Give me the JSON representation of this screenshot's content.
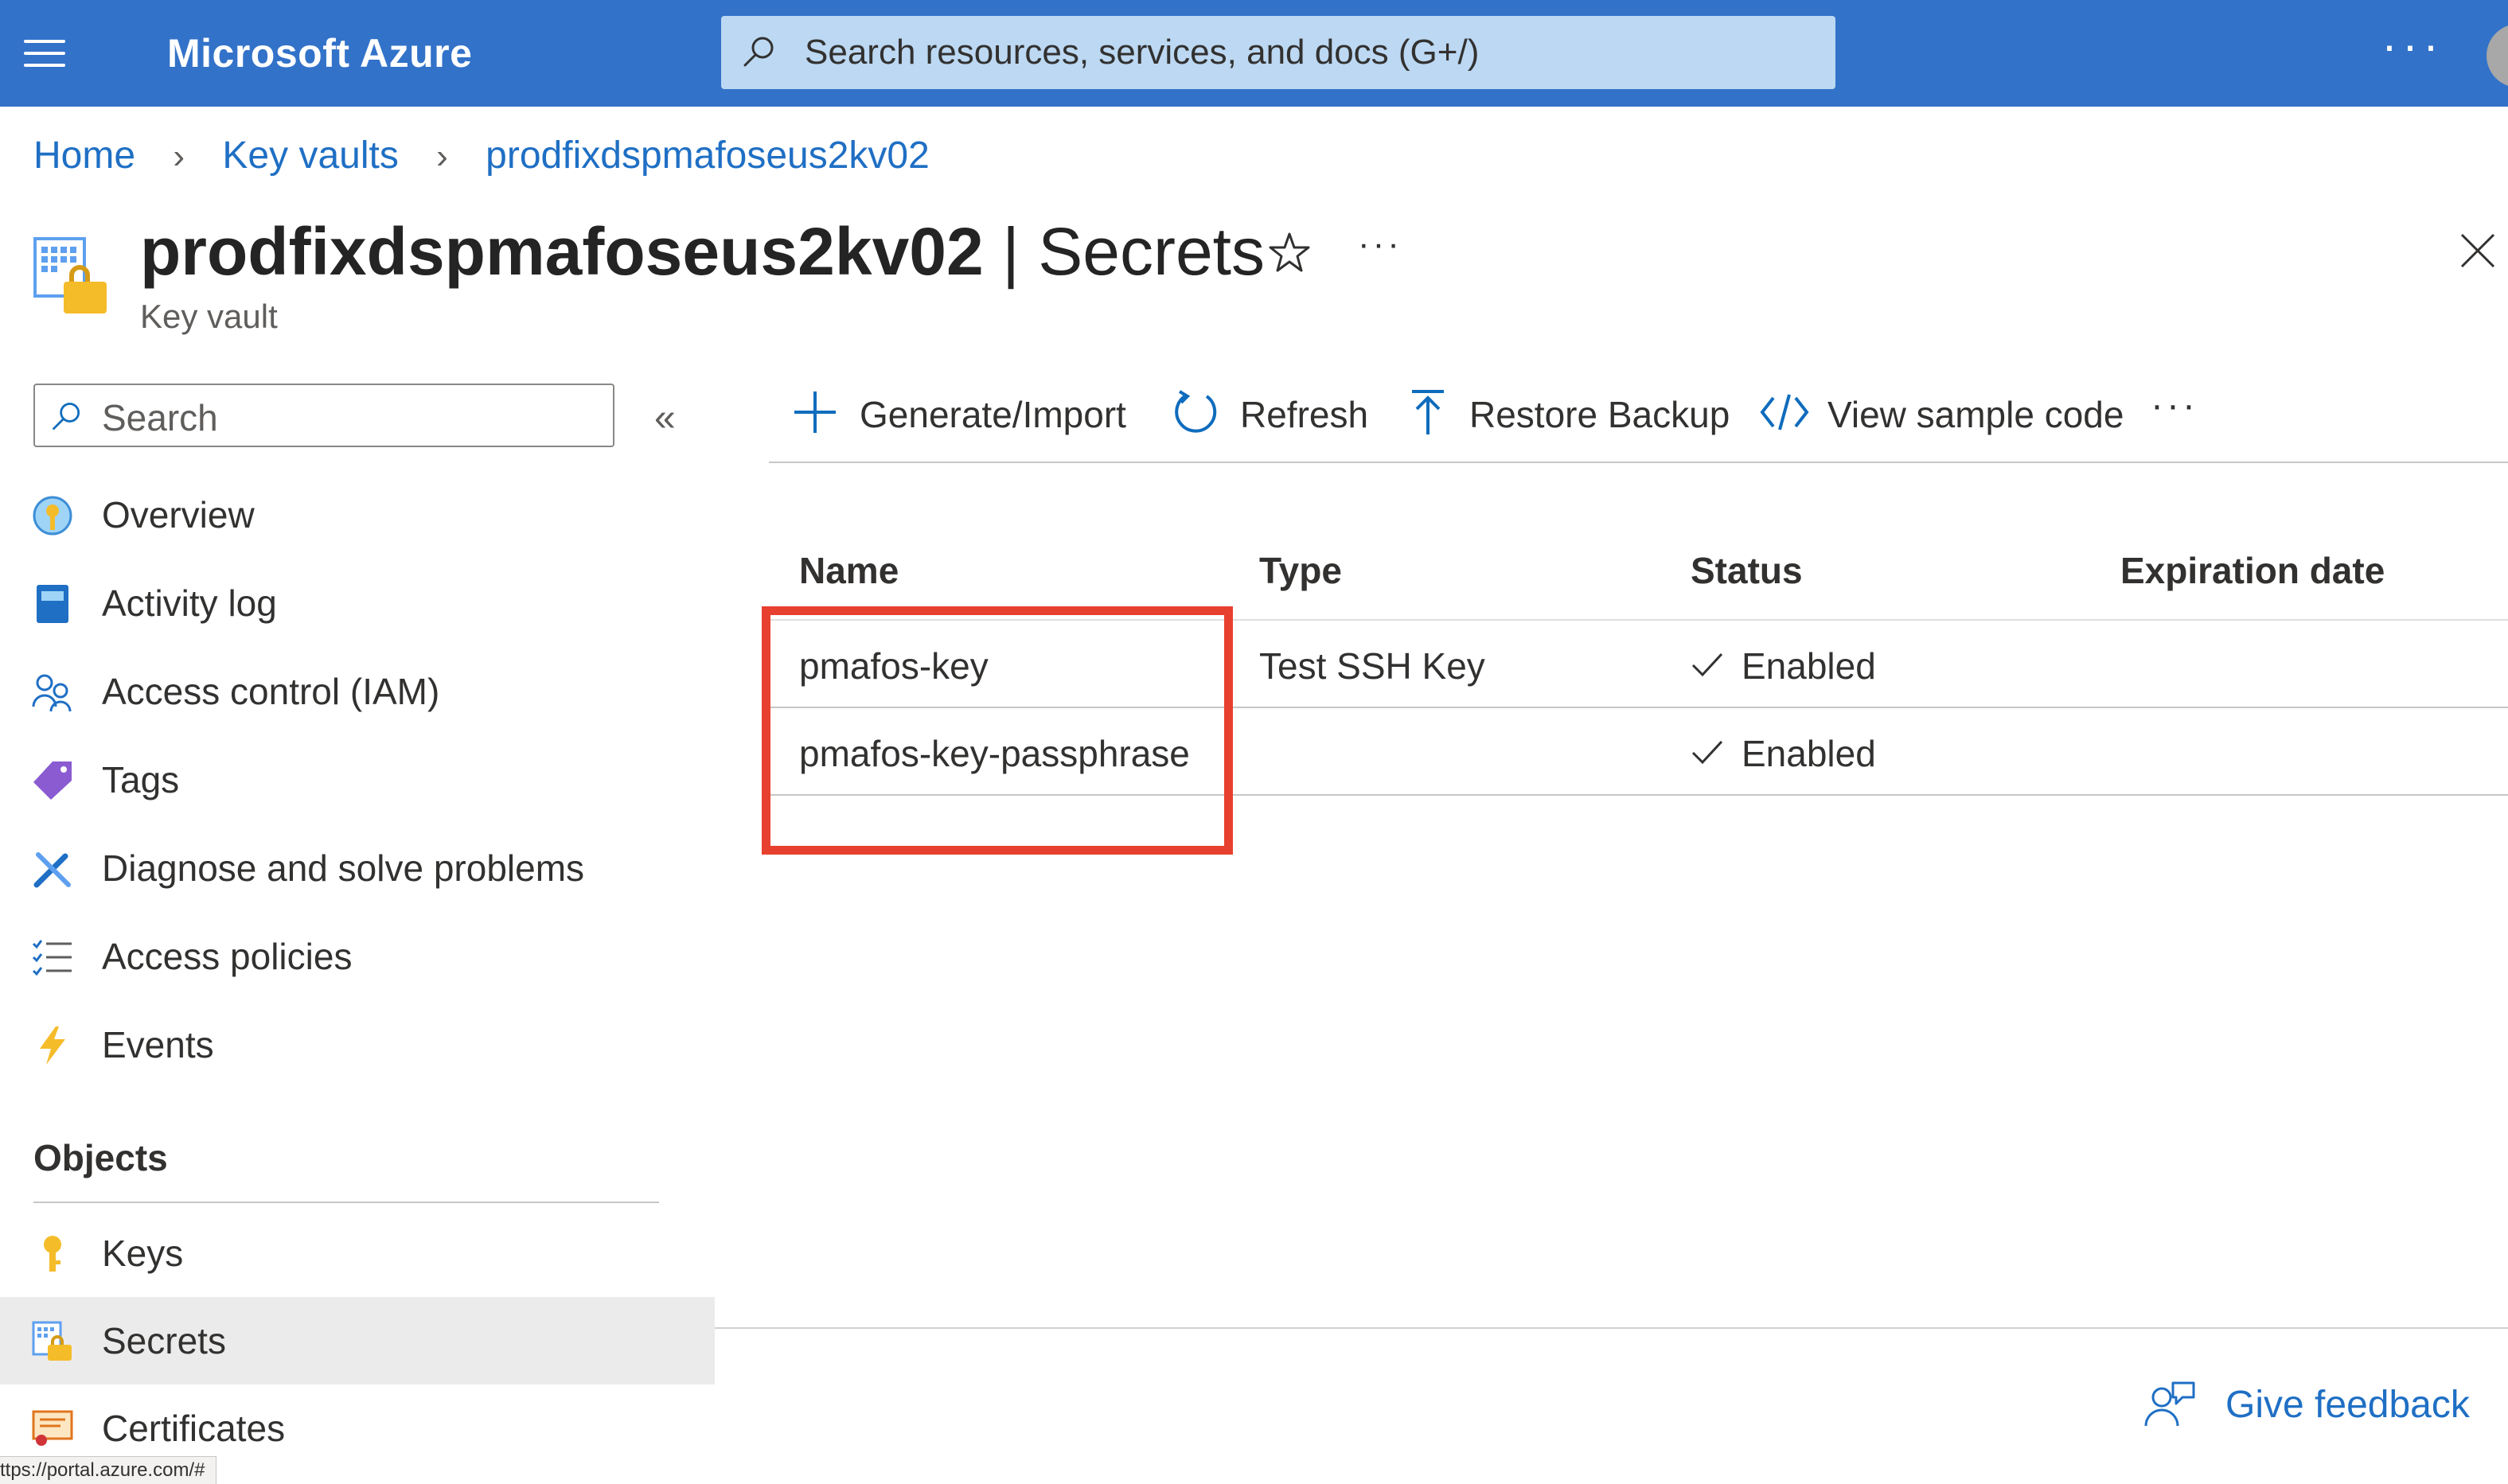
{
  "topbar": {
    "brand": "Microsoft Azure",
    "search_placeholder": "Search resources, services, and docs (G+/)",
    "more": "···"
  },
  "breadcrumb": {
    "items": [
      "Home",
      "Key vaults",
      "prodfixdspmafoseus2kv02"
    ]
  },
  "header": {
    "resource_name": "prodfixdspmafoseus2kv02",
    "section": "| Secrets",
    "subtitle": "Key vault",
    "more": "···"
  },
  "sidebar": {
    "search_placeholder": "Search",
    "collapse": "«",
    "items": [
      {
        "label": "Overview",
        "icon": "overview-icon"
      },
      {
        "label": "Activity log",
        "icon": "activity-log-icon"
      },
      {
        "label": "Access control (IAM)",
        "icon": "iam-icon"
      },
      {
        "label": "Tags",
        "icon": "tag-icon"
      },
      {
        "label": "Diagnose and solve problems",
        "icon": "wrench-icon"
      },
      {
        "label": "Access policies",
        "icon": "list-check-icon"
      },
      {
        "label": "Events",
        "icon": "lightning-icon"
      }
    ],
    "objects_header": "Objects",
    "object_items": [
      {
        "label": "Keys",
        "icon": "key-icon"
      },
      {
        "label": "Secrets",
        "icon": "secret-icon",
        "active": true
      },
      {
        "label": "Certificates",
        "icon": "certificate-icon"
      }
    ]
  },
  "toolbar": {
    "generate_import": "Generate/Import",
    "refresh": "Refresh",
    "restore_backup": "Restore Backup",
    "view_sample_code": "View sample code",
    "more": "···"
  },
  "table": {
    "columns": [
      "Name",
      "Type",
      "Status",
      "Expiration date"
    ],
    "rows": [
      {
        "name": "pmafos-key",
        "type": "Test SSH Key",
        "status": "Enabled",
        "expiration": ""
      },
      {
        "name": "pmafos-key-passphrase",
        "type": "",
        "status": "Enabled",
        "expiration": ""
      }
    ]
  },
  "footer": {
    "feedback": "Give feedback",
    "status_url": "ttps://portal.azure.com/#"
  },
  "colors": {
    "topbar": "#3272c9",
    "link": "#1f6fc4",
    "highlight": "#e8402e"
  }
}
